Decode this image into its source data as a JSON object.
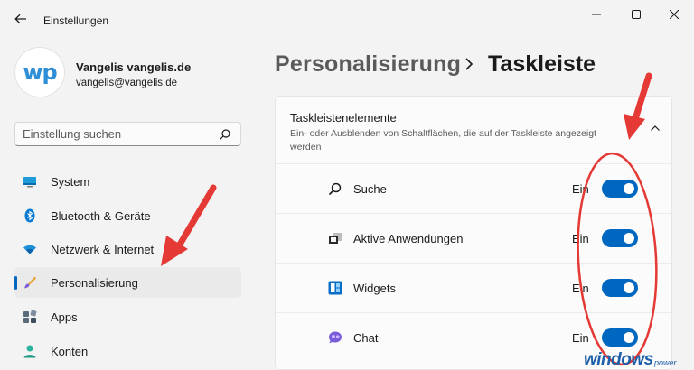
{
  "window": {
    "title": "Einstellungen"
  },
  "profile": {
    "avatar_text": "wp",
    "name": "Vangelis vangelis.de",
    "email": "vangelis@vangelis.de"
  },
  "search": {
    "placeholder": "Einstellung suchen"
  },
  "sidebar": {
    "items": [
      {
        "label": "System",
        "icon": "monitor-icon"
      },
      {
        "label": "Bluetooth & Geräte",
        "icon": "bluetooth-icon"
      },
      {
        "label": "Netzwerk & Internet",
        "icon": "wifi-icon"
      },
      {
        "label": "Personalisierung",
        "icon": "brush-icon",
        "active": true
      },
      {
        "label": "Apps",
        "icon": "apps-icon"
      },
      {
        "label": "Konten",
        "icon": "person-icon"
      }
    ]
  },
  "breadcrumb": {
    "parent": "Personalisierung",
    "current": "Taskleiste"
  },
  "taskbar_items": {
    "title": "Taskleistenelemente",
    "description": "Ein- oder Ausblenden von Schaltflächen, die auf der Taskleiste angezeigt werden",
    "rows": [
      {
        "label": "Suche",
        "state": "Ein",
        "icon": "search-icon",
        "on": true
      },
      {
        "label": "Aktive Anwendungen",
        "state": "Ein",
        "icon": "task-view-icon",
        "on": true
      },
      {
        "label": "Widgets",
        "state": "Ein",
        "icon": "widgets-icon",
        "on": true
      },
      {
        "label": "Chat",
        "state": "Ein",
        "icon": "chat-icon",
        "on": true
      }
    ]
  },
  "watermark": {
    "main": "windows",
    "sub": "power"
  },
  "colors": {
    "accent": "#0067c0",
    "annotation": "#e53935"
  }
}
